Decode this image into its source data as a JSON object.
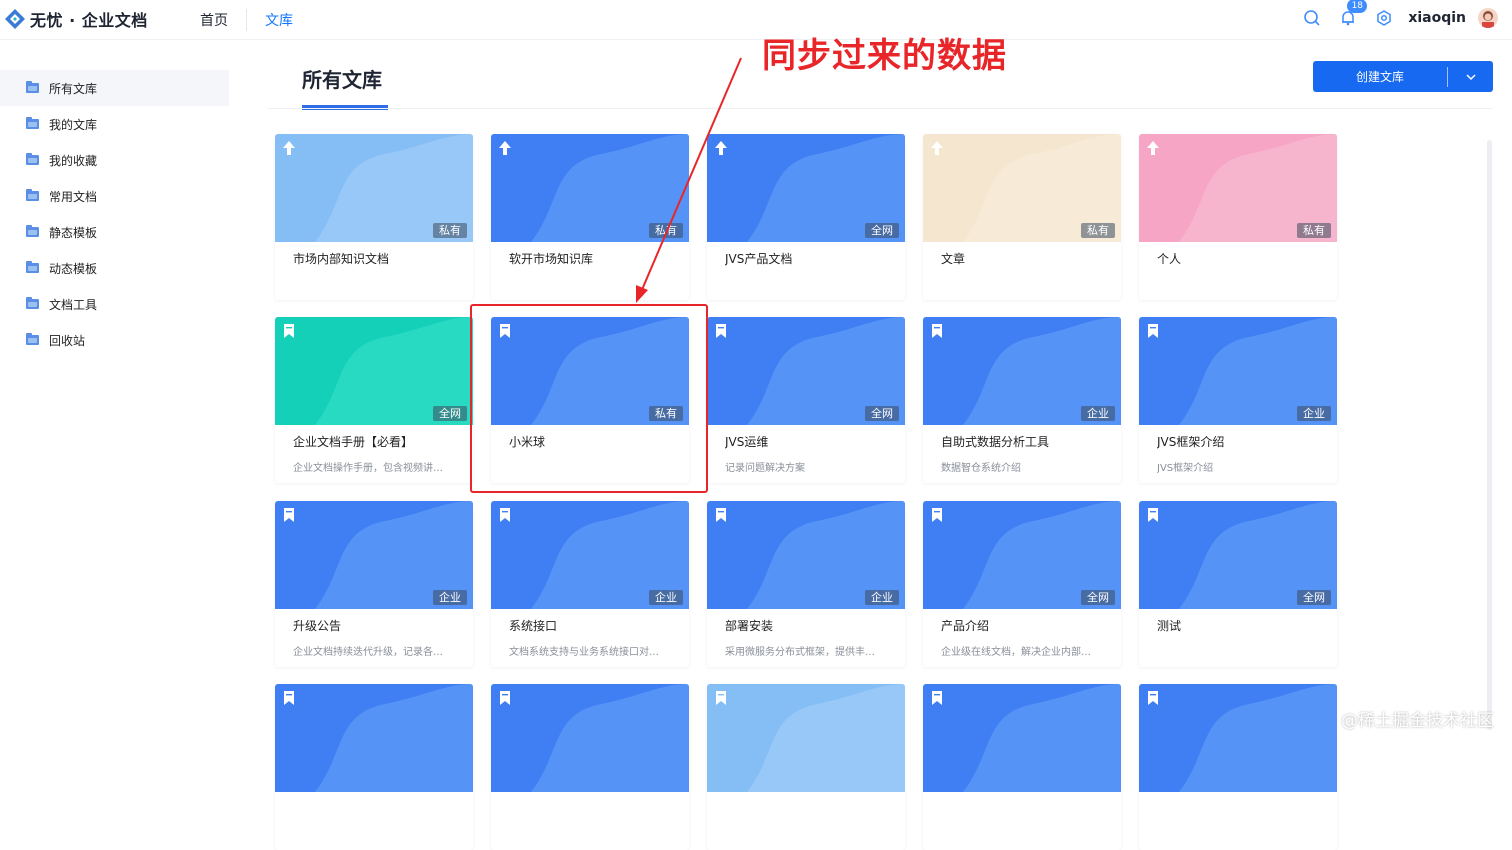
{
  "app": {
    "title": "无忧 · 企业文档"
  },
  "nav": {
    "items": [
      {
        "label": "首页"
      },
      {
        "label": "文库"
      }
    ],
    "active_index": 1
  },
  "topbar": {
    "notification_count": "18",
    "username": "xiaoqin"
  },
  "sidebar": {
    "items": [
      {
        "label": "所有文库",
        "active": true
      },
      {
        "label": "我的文库"
      },
      {
        "label": "我的收藏"
      },
      {
        "label": "常用文档"
      },
      {
        "label": "静态模板"
      },
      {
        "label": "动态模板"
      },
      {
        "label": "文档工具"
      },
      {
        "label": "回收站"
      }
    ]
  },
  "page": {
    "title": "所有文库",
    "create_button": "创建文库"
  },
  "annotation": {
    "text": "同步过来的数据"
  },
  "corner_watermark": "@稀土掘金技术社区",
  "colors": {
    "accent": "#1669f0",
    "annotation": "#e8262a"
  },
  "cards": [
    {
      "title": "市场内部知识文档",
      "desc": "",
      "tag": "私有",
      "cover": "light-blue",
      "icon": "pin-icon"
    },
    {
      "title": "软开市场知识库",
      "desc": "",
      "tag": "私有",
      "cover": "blue",
      "icon": "pin-icon"
    },
    {
      "title": "JVS产品文档",
      "desc": "",
      "tag": "全网",
      "cover": "blue",
      "icon": "pin-icon"
    },
    {
      "title": "文章",
      "desc": "",
      "tag": "私有",
      "cover": "beige",
      "icon": "pin-icon"
    },
    {
      "title": "个人",
      "desc": "",
      "tag": "私有",
      "cover": "pink",
      "icon": "pin-icon"
    },
    {
      "title": "企业文档手册【必看】",
      "desc": "企业文档操作手册，包含视频讲…",
      "tag": "全网",
      "cover": "teal",
      "icon": "bookmark-icon"
    },
    {
      "title": "小米球",
      "desc": "",
      "tag": "私有",
      "cover": "blue",
      "icon": "bookmark-icon"
    },
    {
      "title": "JVS运维",
      "desc": "记录问题解决方案",
      "tag": "全网",
      "cover": "blue",
      "icon": "bookmark-icon"
    },
    {
      "title": "自助式数据分析工具",
      "desc": "数据智仓系统介绍",
      "tag": "企业",
      "cover": "blue",
      "icon": "bookmark-icon"
    },
    {
      "title": "JVS框架介绍",
      "desc": "JVS框架介绍",
      "tag": "企业",
      "cover": "blue",
      "icon": "bookmark-icon"
    },
    {
      "title": "升级公告",
      "desc": "企业文档持续迭代升级，记录各…",
      "tag": "企业",
      "cover": "blue",
      "icon": "bookmark-icon"
    },
    {
      "title": "系统接口",
      "desc": "文档系统支持与业务系统接口对…",
      "tag": "企业",
      "cover": "blue",
      "icon": "bookmark-icon"
    },
    {
      "title": "部署安装",
      "desc": "采用微服务分布式框架，提供丰…",
      "tag": "企业",
      "cover": "blue",
      "icon": "bookmark-icon"
    },
    {
      "title": "产品介绍",
      "desc": "企业级在线文档，解决企业内部…",
      "tag": "全网",
      "cover": "blue",
      "icon": "bookmark-icon"
    },
    {
      "title": "测试",
      "desc": "",
      "tag": "全网",
      "cover": "blue",
      "icon": "bookmark-icon"
    },
    {
      "title": "",
      "desc": "",
      "tag": "",
      "cover": "blue",
      "icon": "bookmark-icon"
    },
    {
      "title": "",
      "desc": "",
      "tag": "",
      "cover": "blue",
      "icon": "bookmark-icon"
    },
    {
      "title": "",
      "desc": "",
      "tag": "",
      "cover": "light-blue",
      "icon": "bookmark-icon"
    },
    {
      "title": "",
      "desc": "",
      "tag": "",
      "cover": "blue",
      "icon": "bookmark-icon"
    },
    {
      "title": "",
      "desc": "",
      "tag": "",
      "cover": "blue",
      "icon": "bookmark-icon"
    }
  ]
}
